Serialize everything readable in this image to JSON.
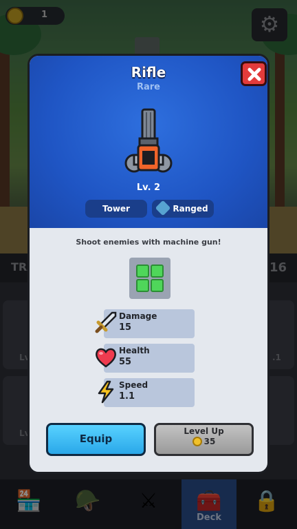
{
  "topbar": {
    "coins": "1",
    "settings_icon": "gear-icon"
  },
  "background": {
    "train_label": "TRA",
    "troop_count": "16",
    "card_level_prefix": "Lv",
    "card_level_right": ".1"
  },
  "nav": {
    "items": [
      {
        "icon": "shop-icon",
        "label": ""
      },
      {
        "icon": "helmet-icon",
        "label": ""
      },
      {
        "icon": "swords-icon",
        "label": ""
      },
      {
        "icon": "deck-icon",
        "label": "Deck"
      },
      {
        "icon": "lock-icon",
        "label": ""
      }
    ]
  },
  "modal": {
    "title": "Rifle",
    "rarity": "Rare",
    "level": "Lv. 2",
    "tags": {
      "tower": "Tower",
      "ranged": "Ranged"
    },
    "description": "Shoot enemies with machine gun!",
    "stats": [
      {
        "name": "Damage",
        "value": "15",
        "icon": "sword-icon"
      },
      {
        "name": "Health",
        "value": "55",
        "icon": "heart-icon"
      },
      {
        "name": "Speed",
        "value": "1.1",
        "icon": "lightning-icon"
      }
    ],
    "equip_label": "Equip",
    "level_up": {
      "label": "Level Up",
      "cost": "35"
    }
  },
  "colors": {
    "header_blue": "#1f55c4",
    "close_red": "#e23b3b",
    "equip_blue": "#3cbcf4",
    "stat_bg": "#b9c6dc"
  }
}
